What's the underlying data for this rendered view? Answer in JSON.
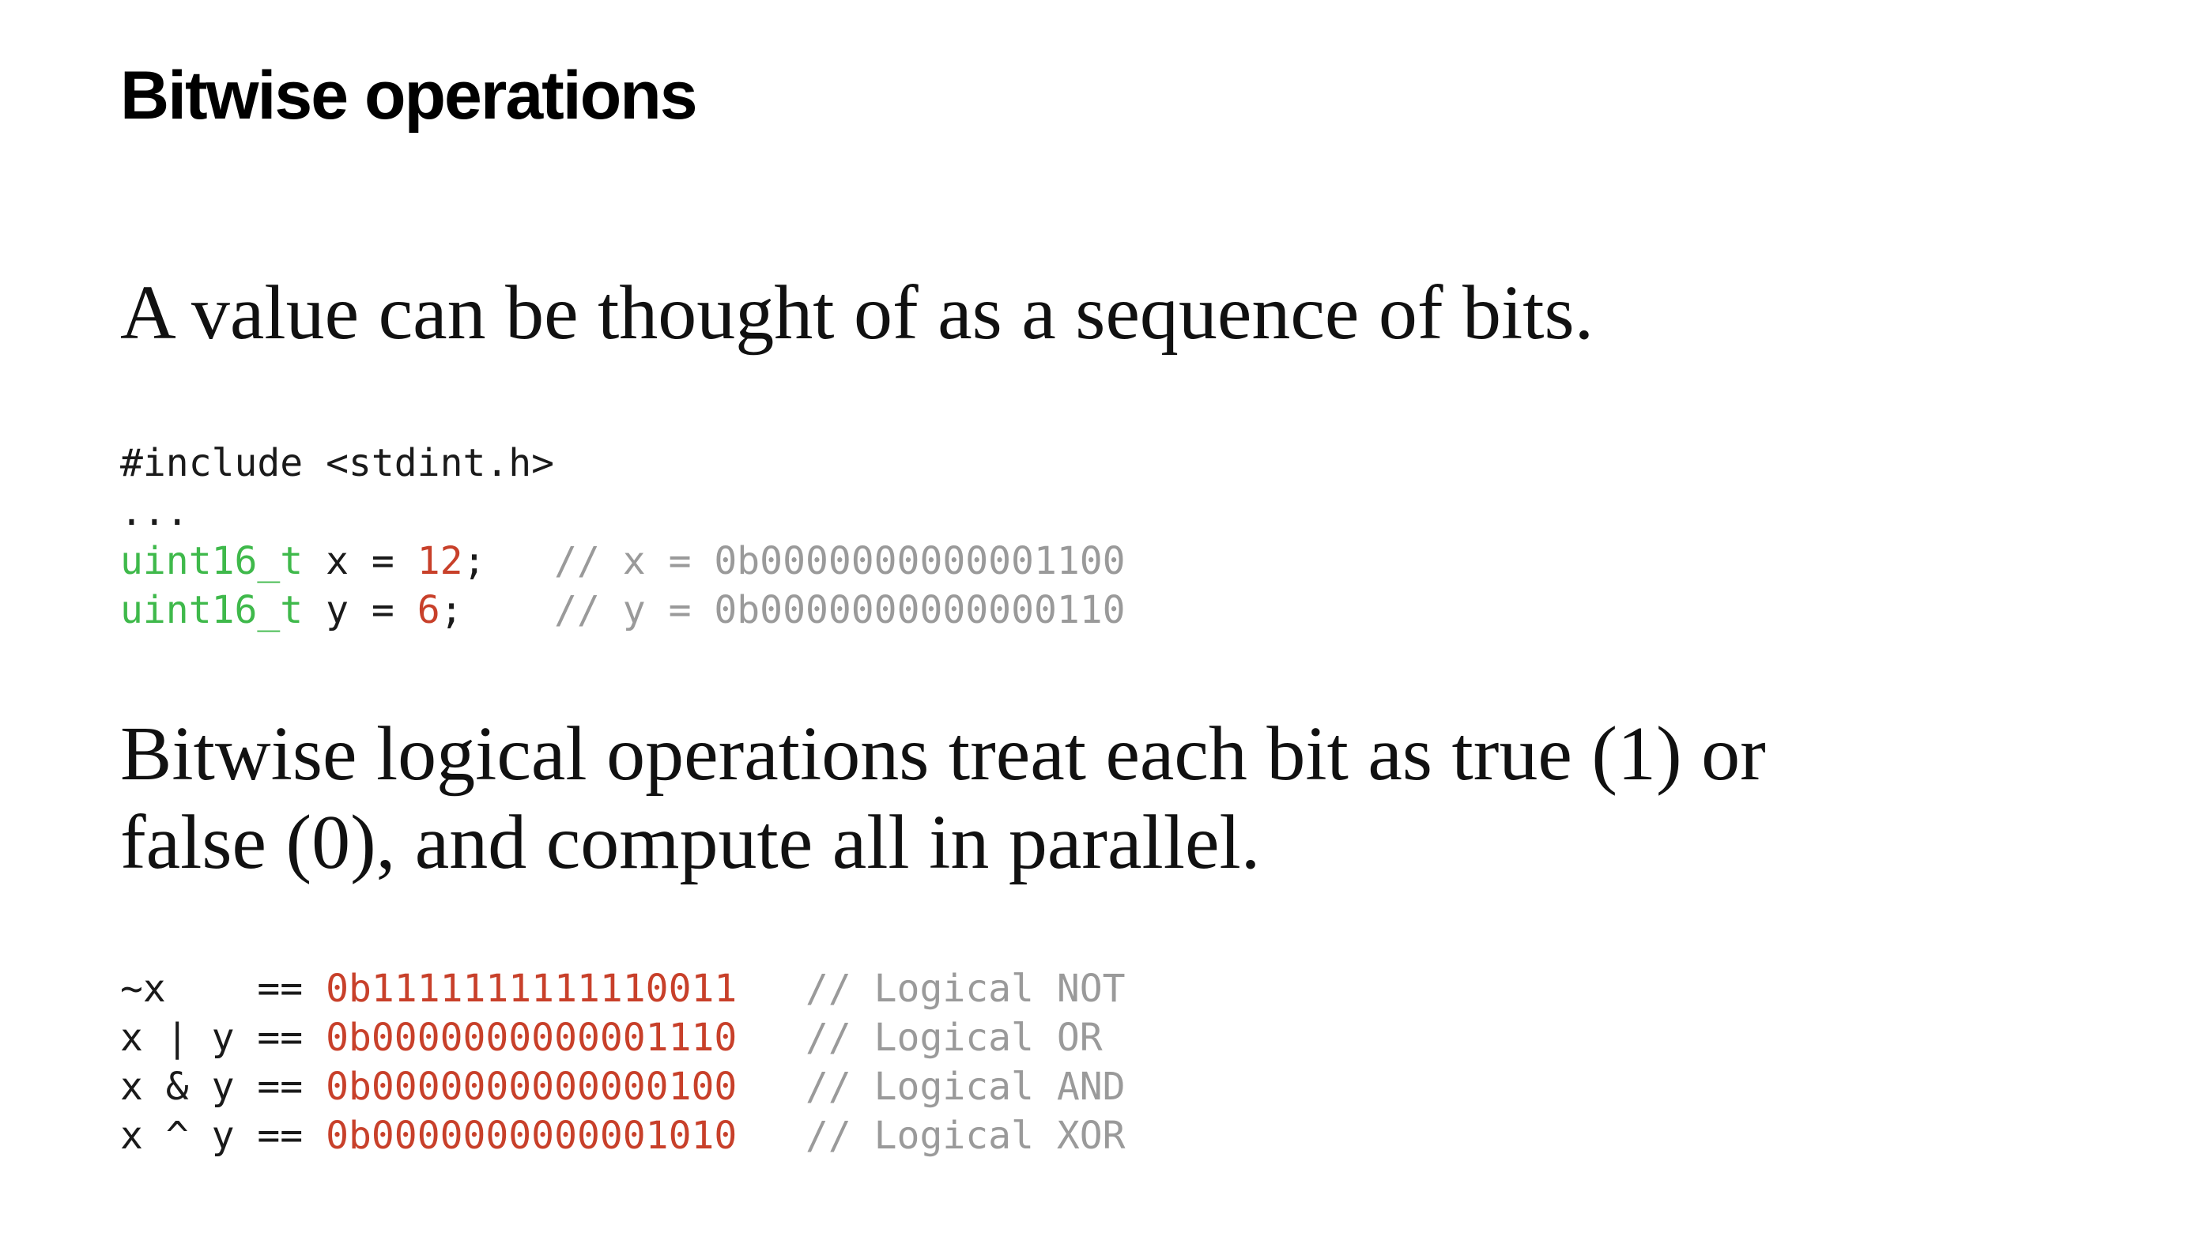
{
  "slide": {
    "title": "Bitwise operations",
    "paragraph1": "A value can be thought of as a sequence of bits.",
    "paragraph2_line1": "Bitwise logical operations treat each bit as true (1) or",
    "paragraph2_line2": "false (0), and compute all in parallel."
  },
  "code1": {
    "include": "#include <stdint.h>",
    "ellipsis": "...",
    "line_x": {
      "type": "uint16_t",
      "decl": " x = ",
      "value": "12",
      "end": ";   ",
      "comment": "// x = 0b0000000000001100"
    },
    "line_y": {
      "type": "uint16_t",
      "decl": " y = ",
      "value": "6",
      "end": ";    ",
      "comment": "// y = 0b0000000000000110"
    }
  },
  "code2": {
    "rows": [
      {
        "expr": "~x    == ",
        "result": "0b1111111111110011",
        "comment": "   // Logical NOT"
      },
      {
        "expr": "x | y == ",
        "result": "0b0000000000001110",
        "comment": "   // Logical OR"
      },
      {
        "expr": "x & y == ",
        "result": "0b0000000000000100",
        "comment": "   // Logical AND"
      },
      {
        "expr": "x ^ y == ",
        "result": "0b0000000000001010",
        "comment": "   // Logical XOR"
      }
    ]
  },
  "colors": {
    "type_keyword": "#3fb94b",
    "number_literal": "#c8402a",
    "comment": "#9a9a9a"
  }
}
